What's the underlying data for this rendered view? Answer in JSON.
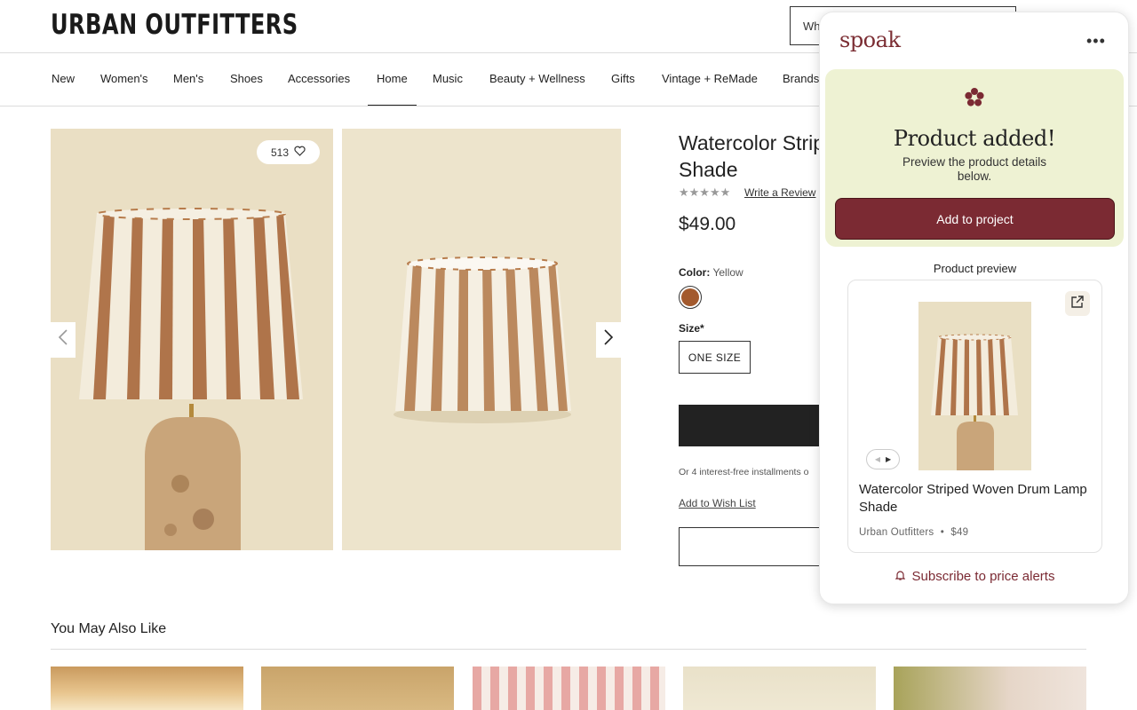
{
  "site": {
    "logo": "URBAN OUTFITTERS",
    "search_text": "Wh"
  },
  "nav": {
    "items": [
      "New",
      "Women's",
      "Men's",
      "Shoes",
      "Accessories",
      "Home",
      "Music",
      "Beauty + Wellness",
      "Gifts",
      "Vintage + ReMade",
      "Brands"
    ],
    "active": "Home"
  },
  "gallery": {
    "likes": "513"
  },
  "product": {
    "title": "Watercolor Strip Shade",
    "write_review": "Write a Review",
    "stars": "★★★★★",
    "price": "$49.00",
    "color_label": "Color:",
    "color_value": "Yellow",
    "swatch_color": "#a35a2e",
    "size_label": "Size*",
    "size_option": "ONE SIZE",
    "installments": "Or 4 interest-free installments o",
    "wish_list": "Add to Wish List"
  },
  "recommendations": {
    "title": "You May Also Like"
  },
  "spoak": {
    "logo": "spoak",
    "more": "•••",
    "added_title": "Product added!",
    "added_sub": "Preview the product details below.",
    "add_to_project": "Add to project",
    "preview_label": "Product preview",
    "preview": {
      "title": "Watercolor Striped Woven Drum Lamp Shade",
      "store": "Urban Outfitters",
      "separator": "•",
      "price": "$49"
    },
    "price_alerts": "Subscribe to price alerts",
    "brand_color": "#7b2a33"
  }
}
